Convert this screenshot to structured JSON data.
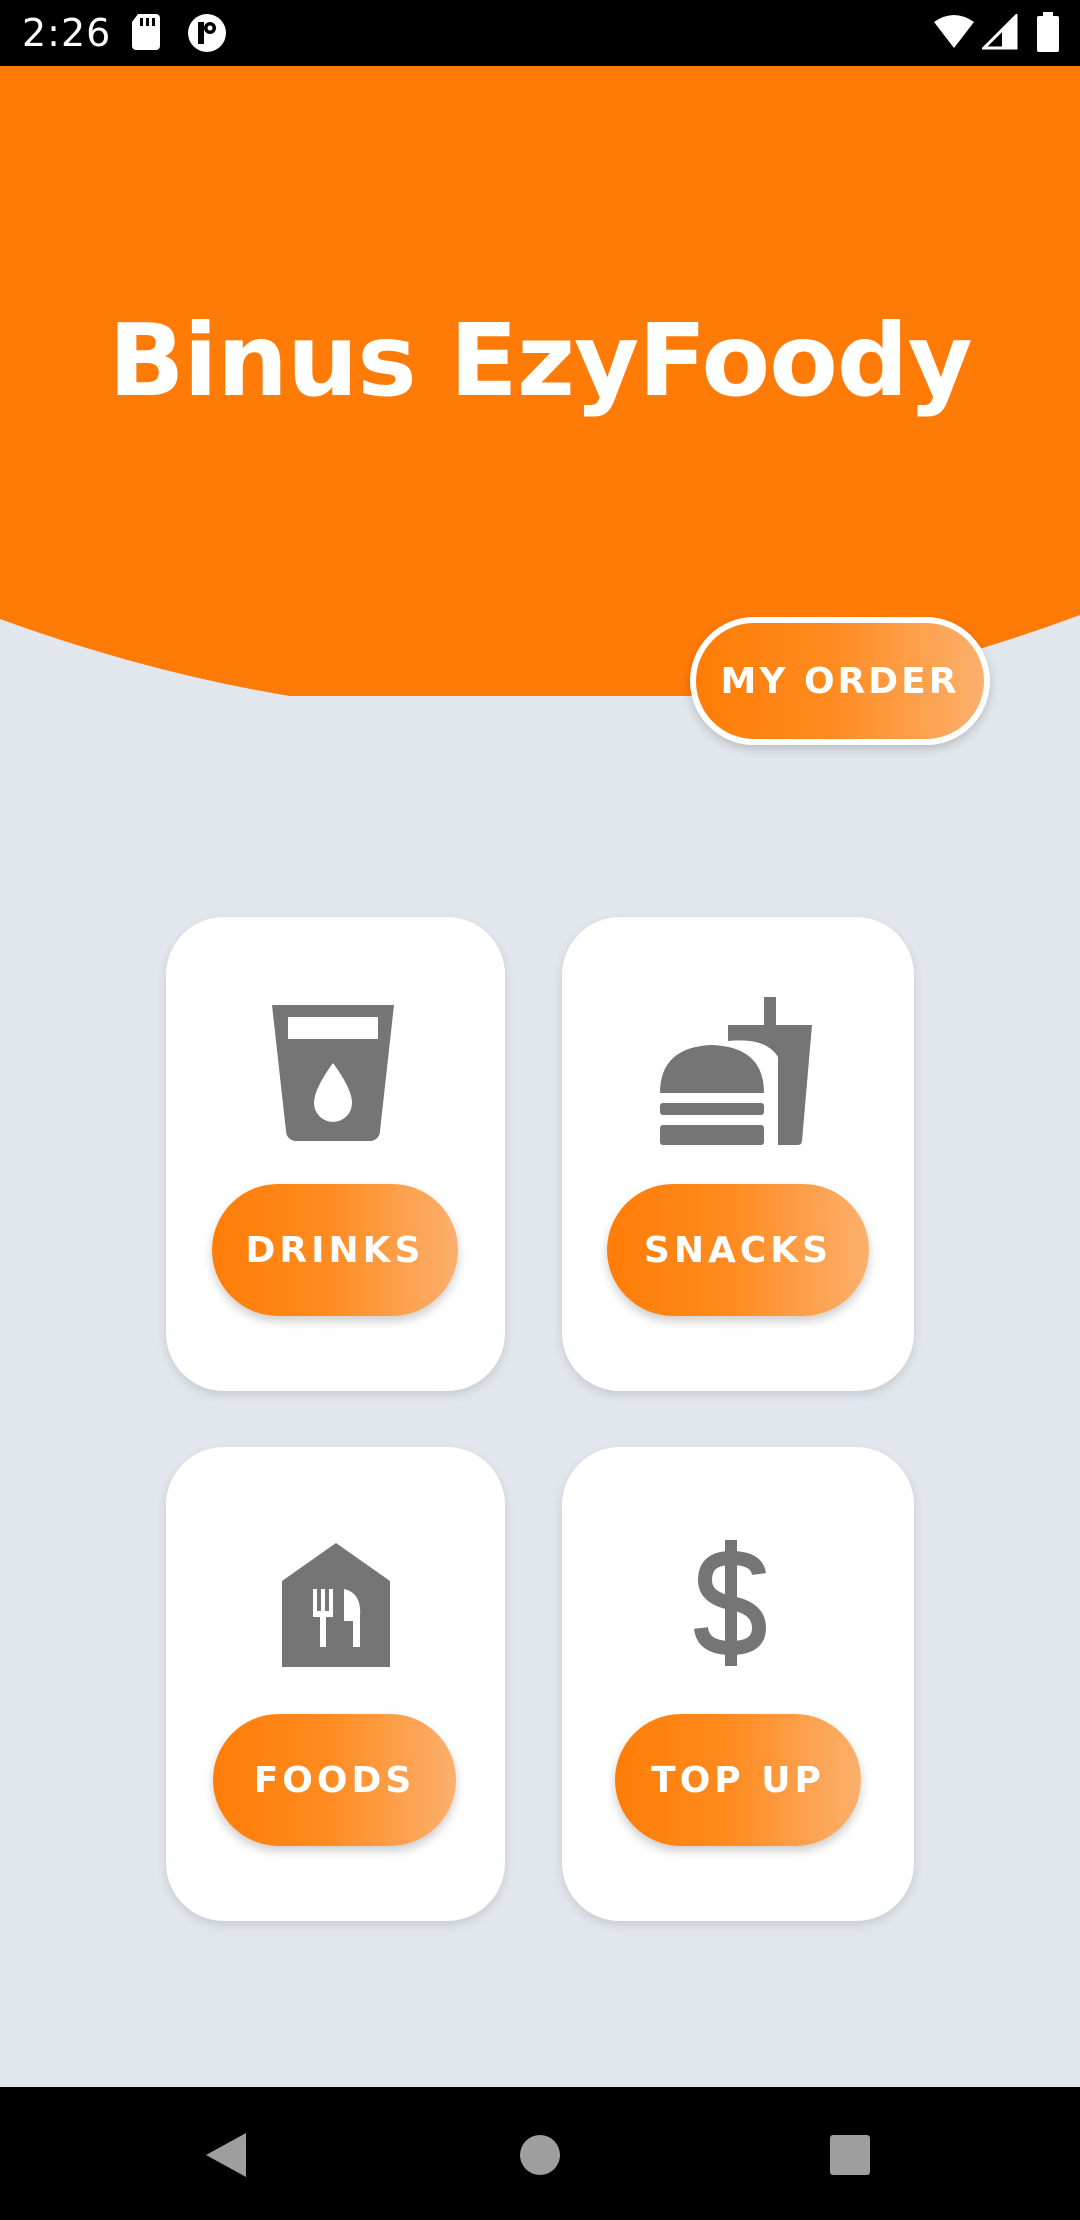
{
  "status_bar": {
    "time": "2:26",
    "icons": [
      "sd-card-icon",
      "notification-app-icon",
      "wifi-icon",
      "cell-signal-icon",
      "battery-icon"
    ]
  },
  "header": {
    "title": "Binus EzyFoody",
    "my_order_label": "MY ORDER"
  },
  "menu": {
    "drinks": {
      "icon": "drink-cup-icon",
      "label": "DRINKS"
    },
    "snacks": {
      "icon": "fastfood-icon",
      "label": "SNACKS"
    },
    "foods": {
      "icon": "restaurant-house-icon",
      "label": "FOODS"
    },
    "topup": {
      "icon": "dollar-icon",
      "label": "TOP UP"
    }
  },
  "nav_bar": {
    "buttons": [
      "back-icon",
      "home-icon",
      "recents-icon"
    ]
  },
  "colors": {
    "primary": "#ff7b07",
    "gradient_end": "#fbb06d",
    "background": "#e2e7ee",
    "icon_gray": "#757575"
  }
}
